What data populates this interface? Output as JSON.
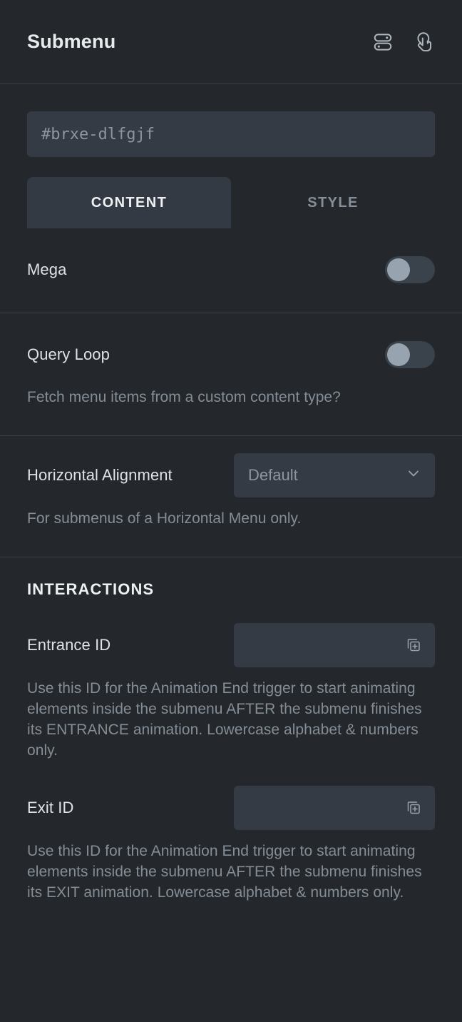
{
  "header": {
    "title": "Submenu",
    "icons": [
      {
        "name": "toggle-settings-icon",
        "label": "Settings"
      },
      {
        "name": "tap-interaction-icon",
        "label": "Interactions"
      }
    ]
  },
  "id_field": {
    "value": "",
    "placeholder": "#brxe-dlfgjf"
  },
  "tabs": [
    {
      "label": "CONTENT",
      "active": true
    },
    {
      "label": "STYLE",
      "active": false
    }
  ],
  "controls": {
    "mega": {
      "label": "Mega",
      "toggle_state": "off"
    },
    "query_loop": {
      "label": "Query Loop",
      "toggle_state": "off",
      "help": "Fetch menu items from a custom content type?"
    },
    "horizontal_alignment": {
      "label": "Horizontal Alignment",
      "value": "Default",
      "help": "For submenus of a Horizontal Menu only.",
      "options": [
        "Default"
      ]
    }
  },
  "interactions": {
    "title": "INTERACTIONS",
    "entrance_id": {
      "label": "Entrance ID",
      "value": "",
      "placeholder": "",
      "help": "Use this ID for the Animation End trigger to start animating elements inside the submenu AFTER the submenu finishes its ENTRANCE animation. Lowercase alphabet & numbers only."
    },
    "exit_id": {
      "label": "Exit ID",
      "value": "",
      "placeholder": "",
      "help": "Use this ID for the Animation End trigger to start animating elements inside the submenu AFTER the submenu finishes its EXIT animation. Lowercase alphabet & numbers only."
    }
  },
  "colors": {
    "panel_bg": "#24282c",
    "field_bg": "#353b45",
    "tab_active_bg": "#333a43",
    "divider": "#3a4149",
    "text_primary": "#e8eaec",
    "text_muted": "#848d96",
    "toggle_knob": "#98a3b0"
  }
}
